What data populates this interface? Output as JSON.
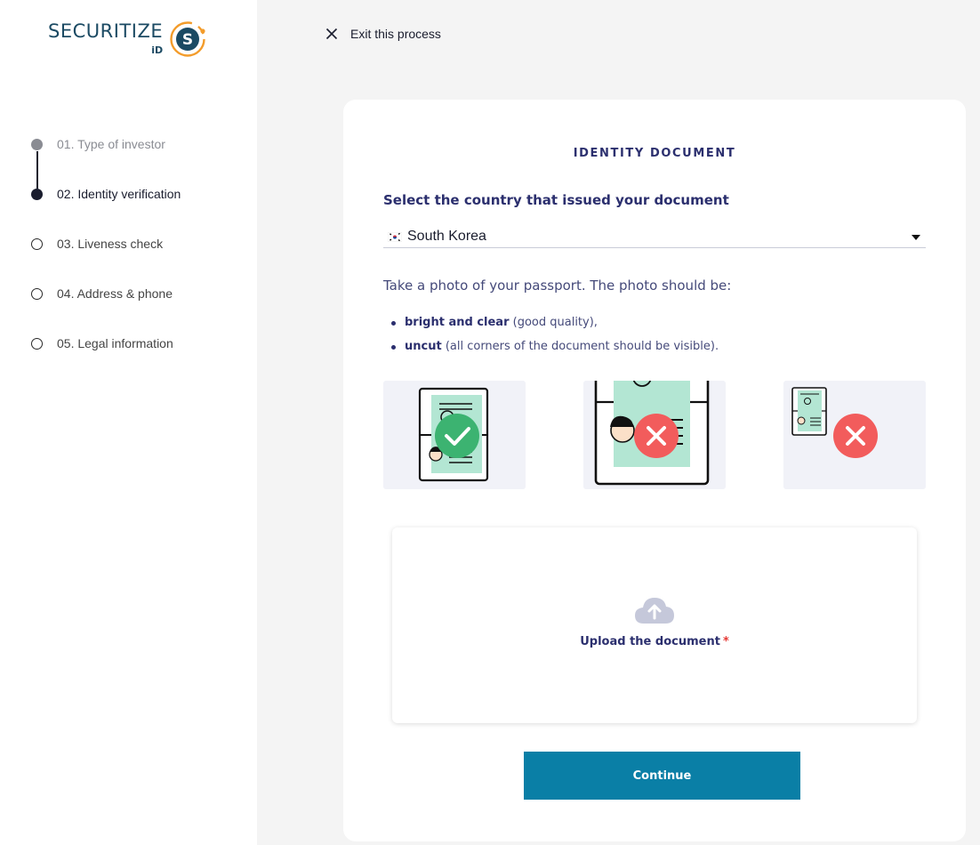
{
  "brand": {
    "name": "SECURITIZE",
    "suffix": "iD",
    "mark_letter": "S",
    "accent": "#f39c2b",
    "primary": "#1b4a63"
  },
  "sidebar": {
    "steps": [
      {
        "label": "01. Type of investor",
        "state": "done"
      },
      {
        "label": "02. Identity verification",
        "state": "current"
      },
      {
        "label": "03. Liveness check",
        "state": "todo"
      },
      {
        "label": "04. Address & phone",
        "state": "todo"
      },
      {
        "label": "05. Legal information",
        "state": "todo"
      }
    ]
  },
  "header": {
    "exit_label": "Exit this process",
    "exit_icon": "close-icon"
  },
  "form": {
    "title": "IDENTITY DOCUMENT",
    "country_label": "Select the country that issued your document",
    "country_value": "South Korea",
    "country_flag": "south-korea-flag",
    "instruction": "Take a photo of your passport. The photo should be:",
    "requirements": [
      {
        "bold": "bright and clear",
        "rest": " (good quality),"
      },
      {
        "bold": "uncut",
        "rest": " (all corners of the document should be visible)."
      }
    ],
    "examples": [
      {
        "name": "good-example",
        "status": "correct",
        "icon": "check-icon"
      },
      {
        "name": "cropped-example",
        "status": "incorrect",
        "icon": "x-icon"
      },
      {
        "name": "too-small-example",
        "status": "incorrect",
        "icon": "x-icon"
      }
    ],
    "upload": {
      "label": "Upload the document",
      "required_marker": "*",
      "icon": "cloud-upload-icon"
    },
    "continue_label": "Continue"
  },
  "colors": {
    "button": "#0a7fa6",
    "heading": "#2b2f6e",
    "ok": "#3cb371",
    "error": "#f25c5c",
    "doc_fill": "#b3e6d3"
  }
}
